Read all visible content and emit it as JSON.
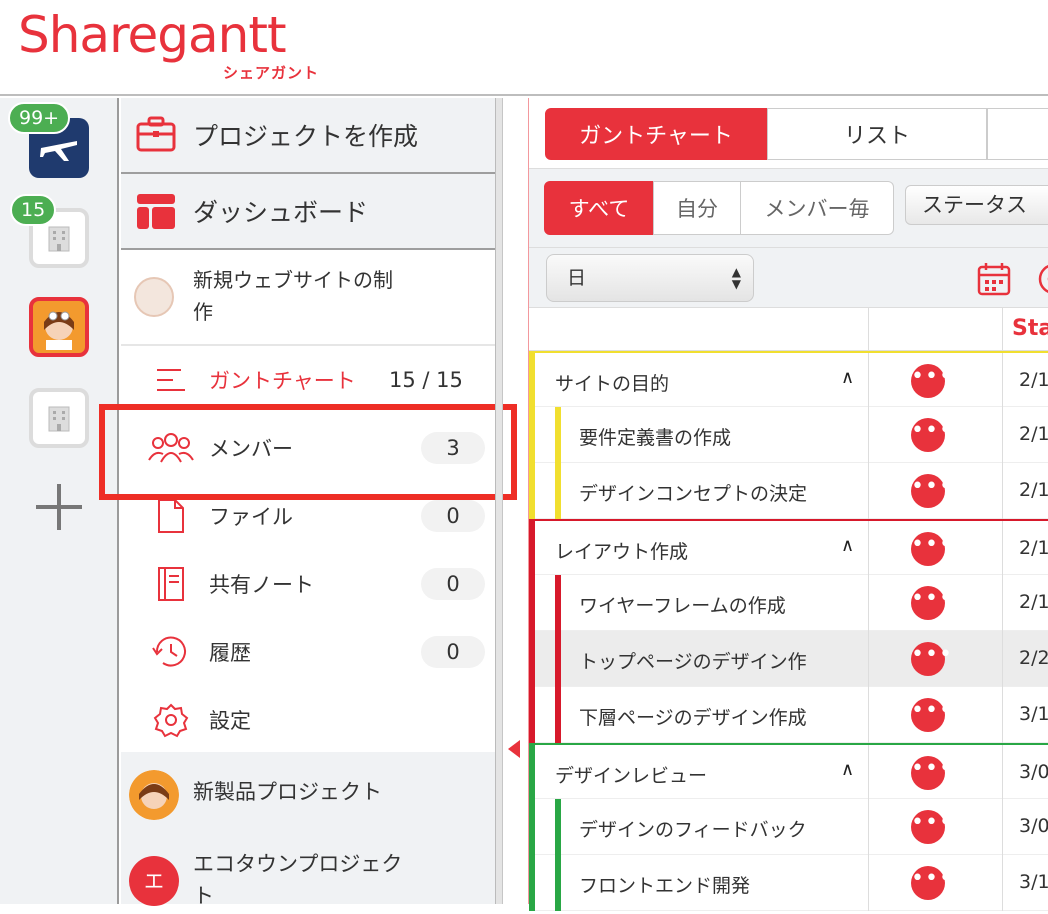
{
  "header": {
    "logo_text": "Sharegantt",
    "logo_sub": "シェアガント"
  },
  "rail": {
    "workspaces": [
      {
        "badge": "99+"
      },
      {
        "badge": "15"
      },
      {
        "badge": ""
      },
      {
        "badge": ""
      }
    ],
    "add_icon": "plus-icon"
  },
  "sidebar": {
    "create_project": "プロジェクトを作成",
    "dashboard": "ダッシュボード",
    "current_project": "新規ウェブサイトの制作",
    "nav": [
      {
        "label": "ガントチャート",
        "value": "15 / 15",
        "icon": "gantt-icon"
      },
      {
        "label": "メンバー",
        "value": "3",
        "icon": "members-icon"
      },
      {
        "label": "ファイル",
        "value": "0",
        "icon": "file-icon"
      },
      {
        "label": "共有ノート",
        "value": "0",
        "icon": "note-icon"
      },
      {
        "label": "履歴",
        "value": "0",
        "icon": "history-icon"
      },
      {
        "label": "設定",
        "value": "",
        "icon": "settings-icon"
      }
    ],
    "other_projects": [
      {
        "title": "新製品プロジェクト",
        "avatar": ""
      },
      {
        "title": "エコタウンプロジェクト",
        "avatar": "エ"
      }
    ]
  },
  "main": {
    "view_tabs": [
      "ガントチャート",
      "リスト",
      ""
    ],
    "filters": [
      "すべて",
      "自分",
      "メンバー毎"
    ],
    "status_filter": "ステータス",
    "scale": "日",
    "start_header": "Sta",
    "rows": [
      {
        "name": "サイトの目的",
        "group": true,
        "color": "yellow",
        "date": "2/1"
      },
      {
        "name": "要件定義書の作成",
        "group": false,
        "color": "yellow",
        "date": "2/1"
      },
      {
        "name": "デザインコンセプトの決定",
        "group": false,
        "color": "yellow",
        "date": "2/1"
      },
      {
        "name": "レイアウト作成",
        "group": true,
        "color": "red",
        "date": "2/1"
      },
      {
        "name": "ワイヤーフレームの作成",
        "group": false,
        "color": "red",
        "date": "2/1"
      },
      {
        "name": "トップページのデザイン作",
        "group": false,
        "color": "red",
        "date": "2/2"
      },
      {
        "name": "下層ページのデザイン作成",
        "group": false,
        "color": "red",
        "date": "3/1"
      },
      {
        "name": "デザインレビュー",
        "group": true,
        "color": "green",
        "date": "3/0"
      },
      {
        "name": "デザインのフィードバック",
        "group": false,
        "color": "green",
        "date": "3/0"
      },
      {
        "name": "フロントエンド開発",
        "group": false,
        "color": "green",
        "date": "3/1"
      }
    ],
    "more_label": "•••",
    "colors": {
      "accent": "#e8323c",
      "yellow": "#f1df2f",
      "red": "#d7192b",
      "green": "#29a745"
    }
  }
}
